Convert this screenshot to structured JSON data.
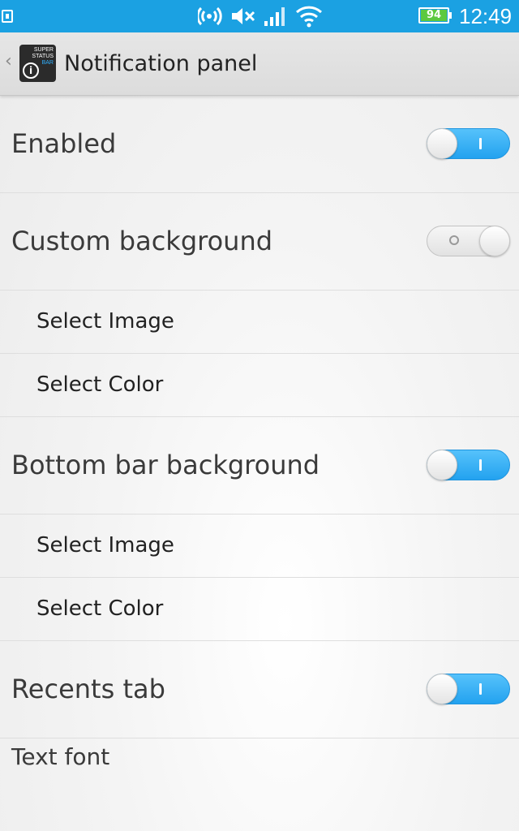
{
  "status_bar": {
    "notification_icon": "sim-card-icon",
    "icons": [
      "hotspot-icon",
      "volume-muted-icon",
      "signal-icon",
      "wifi-icon"
    ],
    "battery_level": "94",
    "time": "12:49",
    "bar_color": "#1ba1e2"
  },
  "action_bar": {
    "back_icon": "chevron-left-icon",
    "app_icon_lines": [
      "SUPER",
      "STATUS",
      "BAR"
    ],
    "app_icon_glyph": "i",
    "title": "Notification panel"
  },
  "settings": {
    "enabled": {
      "label": "Enabled",
      "on": true
    },
    "custom_background": {
      "label": "Custom background",
      "on": false,
      "select_image": "Select Image",
      "select_color": "Select Color"
    },
    "bottom_bar_background": {
      "label": "Bottom bar background",
      "on": true,
      "select_image": "Select Image",
      "select_color": "Select Color"
    },
    "recents_tab": {
      "label": "Recents tab",
      "on": true
    },
    "text_font": {
      "label": "Text font"
    }
  },
  "colors": {
    "toggle_on": "#23a2ef",
    "toggle_off": "#e2e2e2"
  }
}
